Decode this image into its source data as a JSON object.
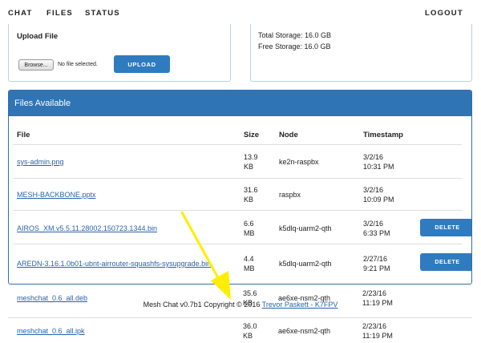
{
  "nav": {
    "chat": "CHAT",
    "files": "FILES",
    "status": "STATUS",
    "logout": "LOGOUT"
  },
  "upload": {
    "title": "Upload File",
    "browse_label": "Browse...",
    "no_file_text": "No file selected.",
    "upload_label": "UPLOAD"
  },
  "storage": {
    "total": "Total Storage: 16.0 GB",
    "free": "Free Storage: 16.0 GB"
  },
  "files": {
    "title": "Files Available",
    "columns": [
      "File",
      "Size",
      "Node",
      "Timestamp"
    ],
    "delete_label": "DELETE",
    "rows": [
      {
        "file": "sys-admin.png",
        "size_num": "13.9",
        "size_unit": "KB",
        "node": "ke2n-raspbx",
        "date": "3/2/16",
        "time": "10:31 PM",
        "deletable": false
      },
      {
        "file": "MESH-BACKBONE.pptx",
        "size_num": "31.6",
        "size_unit": "KB",
        "node": "raspbx",
        "date": "3/2/16",
        "time": "10:09 PM",
        "deletable": false
      },
      {
        "file": "AIROS_XM.v5.5.11.28002.150723.1344.bin",
        "size_num": "6.6",
        "size_unit": "MB",
        "node": "k5dlq-uarm2-qth",
        "date": "3/2/16",
        "time": "6:33 PM",
        "deletable": true
      },
      {
        "file": "AREDN-3.16.1.0b01-ubnt-airrouter-squashfs-sysupgrade.bin",
        "size_num": "4.4",
        "size_unit": "MB",
        "node": "k5dlq-uarm2-qth",
        "date": "2/27/16",
        "time": "9:21 PM",
        "deletable": true
      },
      {
        "file": "meshchat_0.6_all.deb",
        "size_num": "35.6",
        "size_unit": "KB",
        "node": "ae6xe-nsm2-qth",
        "date": "2/23/16",
        "time": "11:19 PM",
        "deletable": false
      },
      {
        "file": "meshchat_0.6_all.ipk",
        "size_num": "36.0",
        "size_unit": "KB",
        "node": "ae6xe-nsm2-qth",
        "date": "2/23/16",
        "time": "11:19 PM",
        "deletable": false
      }
    ]
  },
  "footer": {
    "text": "Mesh Chat v0.7b1 Copyright © 2016",
    "author_link": "Trevor Paskett - K7FPV"
  },
  "colors": {
    "accent": "#2f7bbf",
    "header_blue": "#2f74b5",
    "link": "#2b63a6",
    "annotation_arrow": "#ffee00"
  }
}
